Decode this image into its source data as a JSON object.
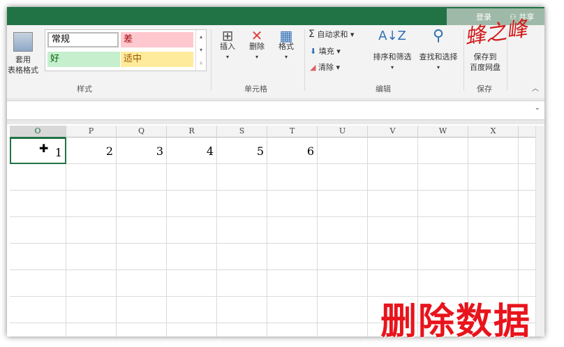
{
  "account": {
    "login": "登录",
    "share": "共享"
  },
  "ribbon": {
    "table_format": "套用\n表格格式",
    "styles": [
      {
        "label": "常规",
        "bg": "#ffffff",
        "fg": "#000000"
      },
      {
        "label": "差",
        "bg": "#ffc7ce",
        "fg": "#9c0006"
      },
      {
        "label": "好",
        "bg": "#c6efce",
        "fg": "#006100"
      },
      {
        "label": "适中",
        "bg": "#ffeb9c",
        "fg": "#9c5700"
      }
    ],
    "group_styles": "样式",
    "insert": "插入",
    "delete": "删除",
    "format": "格式",
    "group_cells": "单元格",
    "autosum": "自动求和",
    "fill": "填充",
    "clear": "清除",
    "sort_filter": "排序和筛选",
    "find_select": "查找和选择",
    "group_edit": "编辑",
    "save_to": "保存到",
    "baidu": "百度网盘",
    "group_save": "保存"
  },
  "columns": [
    "O",
    "P",
    "Q",
    "R",
    "S",
    "T",
    "U",
    "V",
    "W",
    "X"
  ],
  "row1": [
    "1",
    "2",
    "3",
    "4",
    "5",
    "6",
    "",
    "",
    "",
    ""
  ],
  "watermark": "删除数据",
  "logo_text": "蜂之峰"
}
